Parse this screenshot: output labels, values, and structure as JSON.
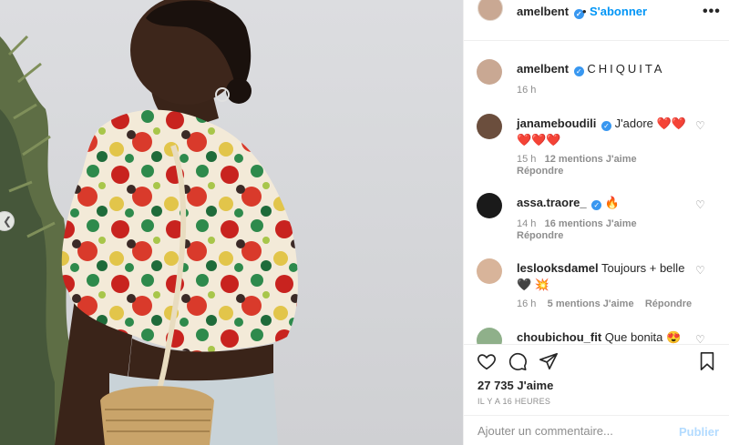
{
  "post": {
    "author": "amelbent",
    "follow_label": "S'abonner",
    "separator": "•",
    "more_label": "•••",
    "verified_glyph": "✓",
    "caption": {
      "user": "amelbent",
      "text": "CHIQUITA",
      "time": "16 h"
    },
    "comments": [
      {
        "user": "janameboudili",
        "text": "J'adore",
        "emoji": "❤️❤️ ❤️❤️❤️",
        "time": "15 h",
        "likes": "12 mentions J'aime",
        "reply": "Répondre",
        "verified": true,
        "avatar_color": "#6b4e3d"
      },
      {
        "user": "assa.traore_",
        "text": "",
        "emoji": "🔥",
        "time": "14 h",
        "likes": "16 mentions J'aime",
        "reply": "Répondre",
        "verified": true,
        "avatar_color": "#1a1a1a"
      },
      {
        "user": "leslooksdamel",
        "text": "Toujours + belle",
        "emoji": "🖤 💥",
        "time": "16 h",
        "likes": "5 mentions J'aime",
        "reply": "Répondre",
        "verified": false,
        "avatar_color": "#d8b49a"
      },
      {
        "user": "choubichou_fit",
        "text": "Que bonita",
        "emoji": "😍❤️",
        "time": "",
        "likes": "",
        "reply": "",
        "verified": false,
        "avatar_color": "#8fb08a"
      }
    ],
    "likes_count": "27 735 J'aime",
    "posted_ago": "IL Y A 16 HEURES",
    "add_comment_placeholder": "Ajouter un commentaire...",
    "publish_label": "Publier"
  },
  "icons": [
    "heart-icon",
    "comment-icon",
    "share-icon",
    "bookmark-icon",
    "more-icon",
    "verified-icon",
    "chevron-left-icon"
  ],
  "colors": {
    "link": "#0095f6",
    "verified": "#3897f0",
    "publish_disabled": "#b3dbff",
    "meta": "#8e8e8e"
  }
}
